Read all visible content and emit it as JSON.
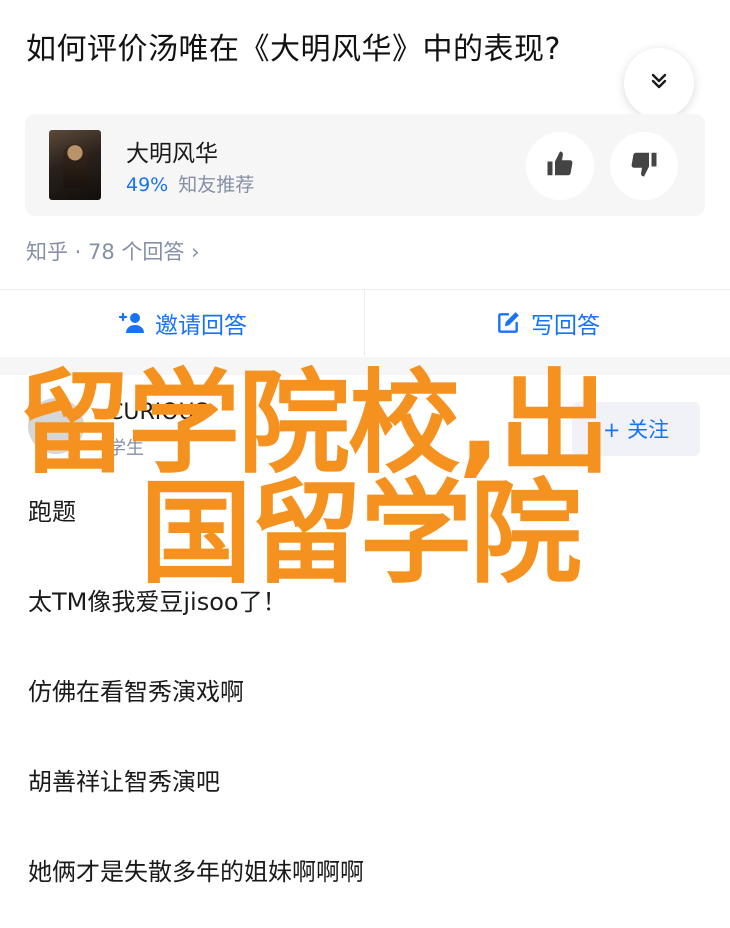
{
  "question": {
    "title": "如何评价汤唯在《大明风华》中的表现?"
  },
  "card": {
    "title": "大明风华",
    "percent": "49%",
    "sub": "知友推荐"
  },
  "meta": "知乎 · 78 个回答 ›",
  "actions": {
    "invite_label": "邀请回答",
    "write_label": "写回答"
  },
  "author": {
    "name": "CURIOUS",
    "sub": "学生",
    "follow_label": "+ 关注"
  },
  "answer_lines": [
    "跑题",
    "太TM像我爱豆jisoo了！",
    "仿佛在看智秀演戏啊",
    "胡善祥让智秀演吧",
    "她俩才是失散多年的姐妹啊啊啊"
  ],
  "overlay": {
    "line1": "留学院校,出",
    "line2": "国留学院"
  },
  "colors": {
    "accent": "#1772f6",
    "muted": "#8590a6",
    "overlay": "#f5921f"
  },
  "icons": [
    "chevron-double-down-icon",
    "thumbs-up-icon",
    "thumbs-down-icon",
    "add-person-icon",
    "edit-icon"
  ]
}
